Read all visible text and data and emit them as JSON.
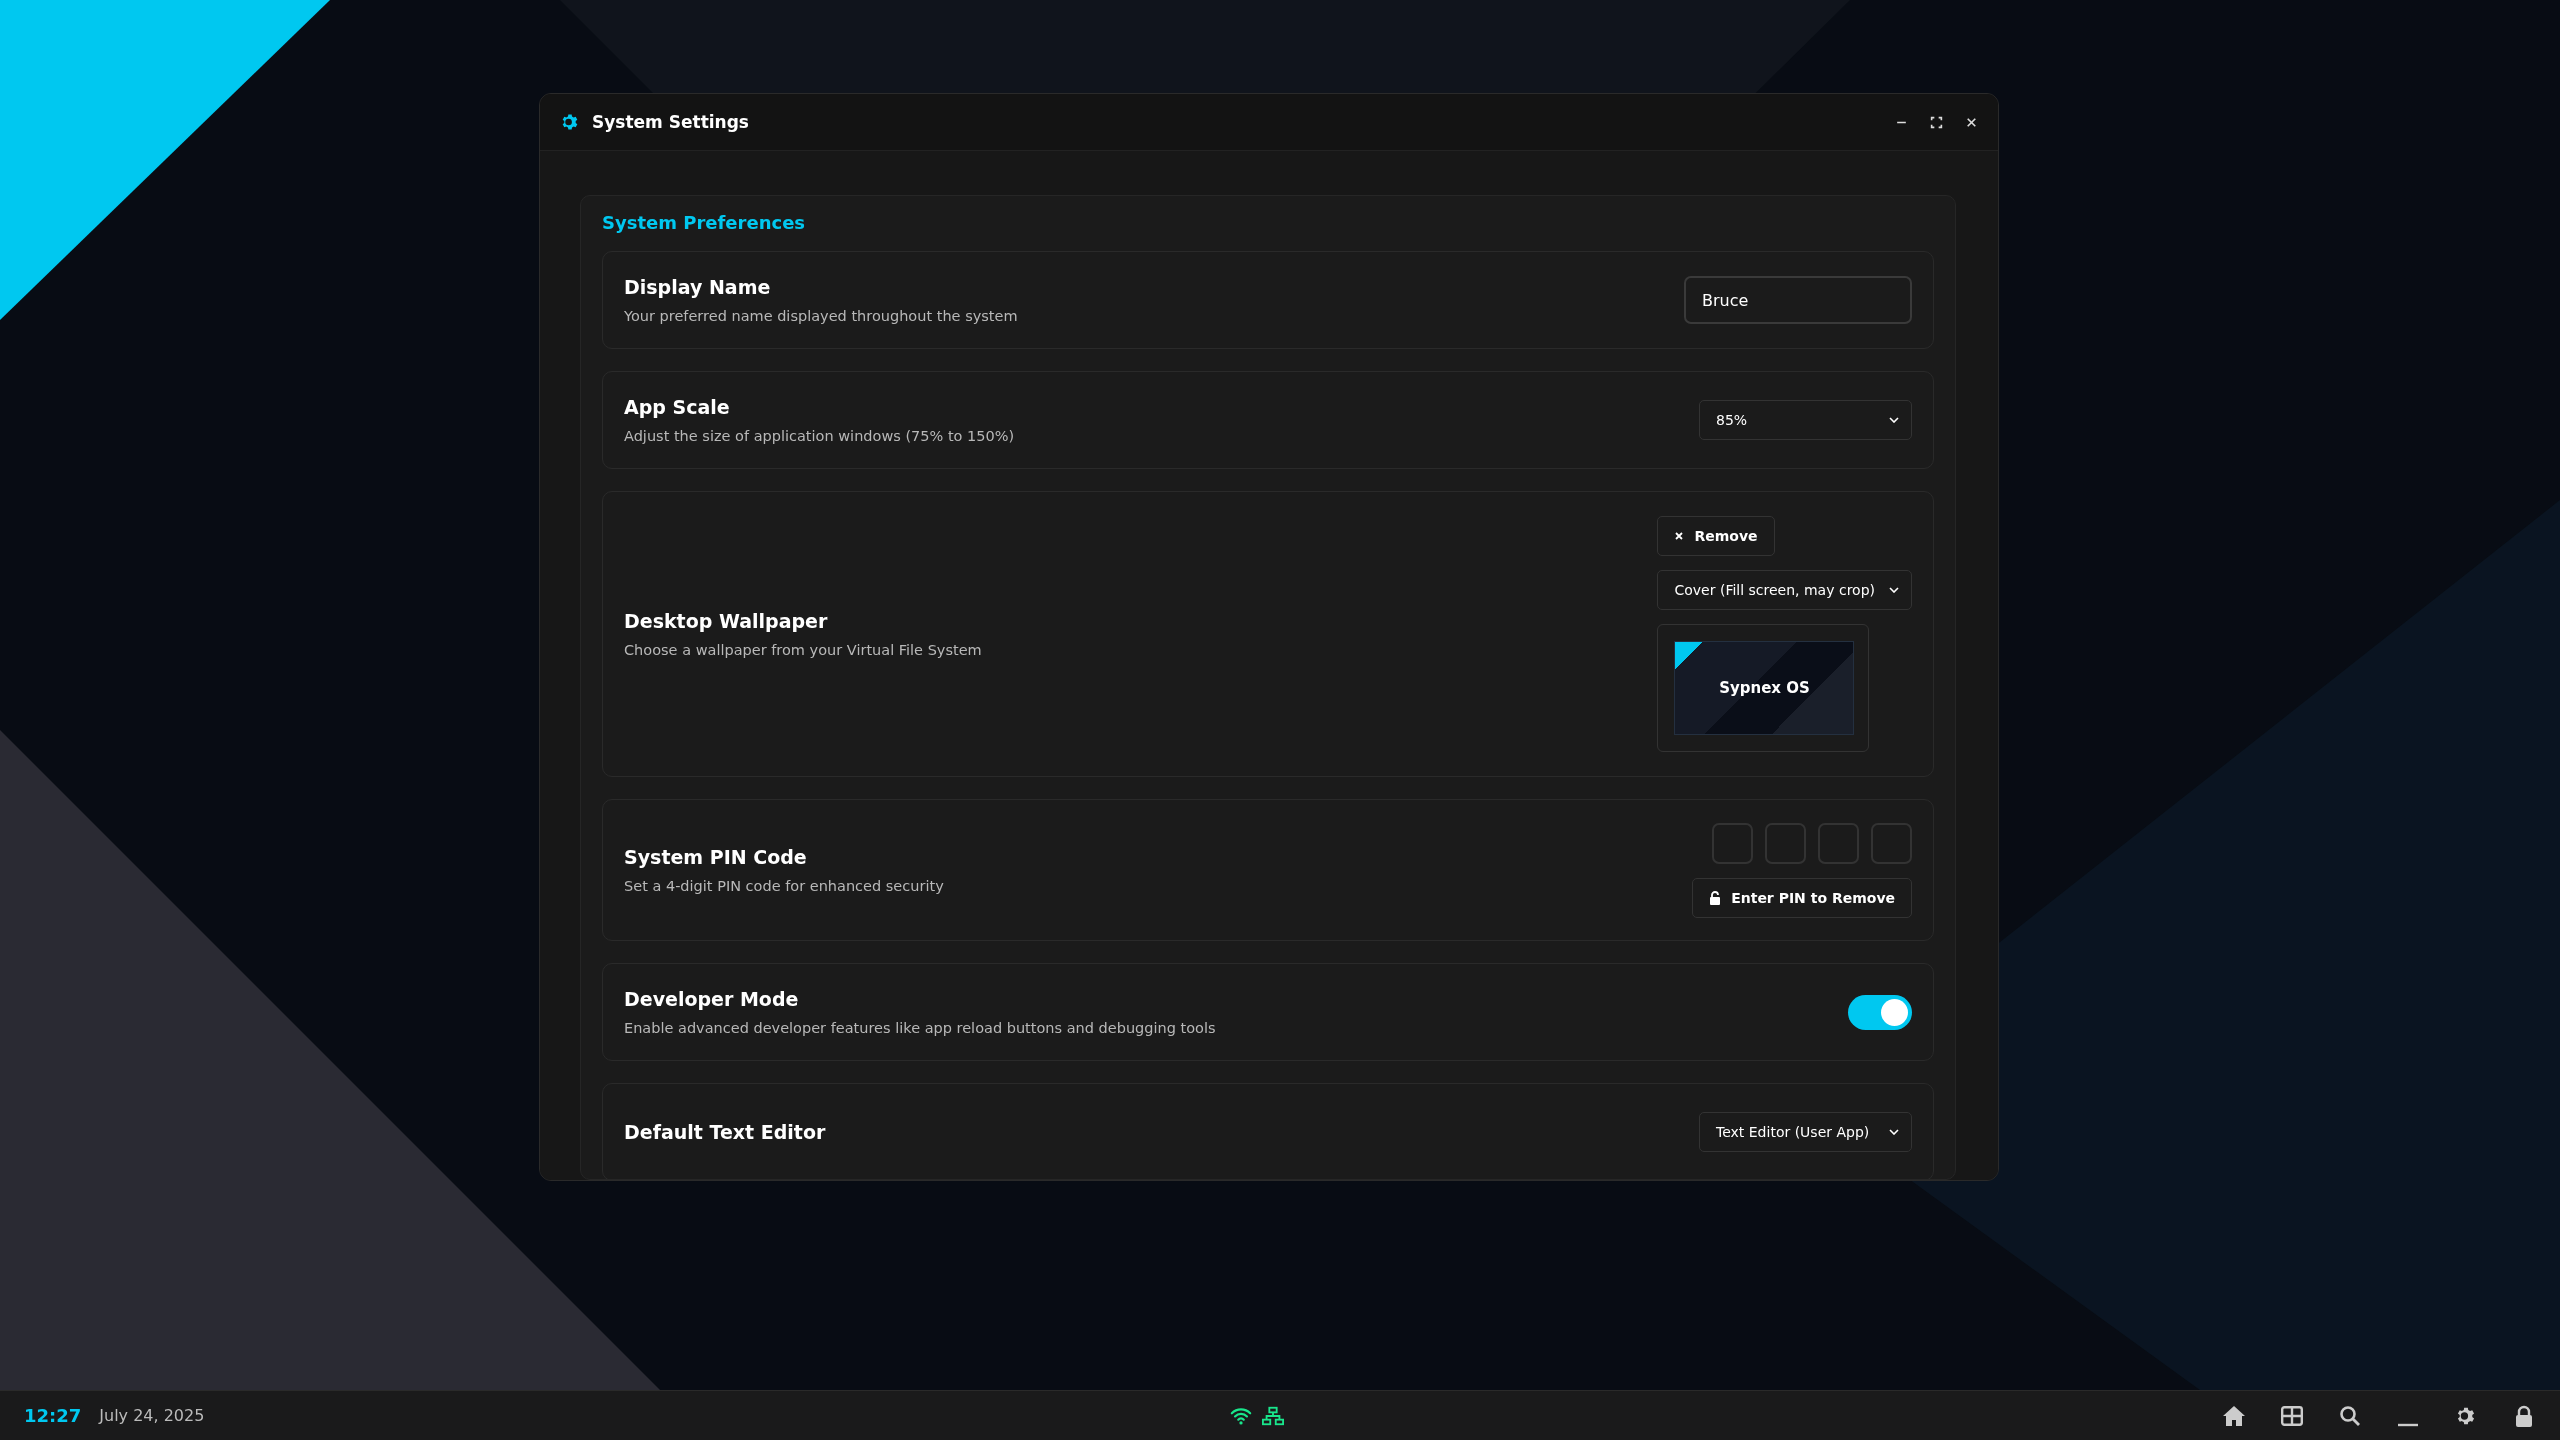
{
  "window": {
    "title": "System Settings"
  },
  "section": {
    "title": "System Preferences"
  },
  "settings": [
    {
      "kind": "input",
      "title": "Display Name",
      "description": "Your preferred name displayed throughout the system",
      "value": "Bruce"
    },
    {
      "kind": "select",
      "title": "App Scale",
      "description": "Adjust the size of application windows (75% to 150%)",
      "value": "85%"
    },
    {
      "kind": "wallpaper",
      "title": "Desktop Wallpaper",
      "description": "Choose a wallpaper from your Virtual File System",
      "remove_label": "Remove",
      "fit": "Cover (Fill screen, may crop)",
      "preview_label": "Sypnex OS"
    },
    {
      "kind": "pin",
      "title": "System PIN Code",
      "description": "Set a 4-digit PIN code for enhanced security",
      "button": "Enter PIN to Remove"
    },
    {
      "kind": "toggle",
      "title": "Developer Mode",
      "description": "Enable advanced developer features like app reload buttons and debugging tools",
      "on": true
    },
    {
      "kind": "select",
      "title": "Default Text Editor",
      "value": "Text Editor (User App)"
    }
  ],
  "taskbar": {
    "time": "12:27",
    "date": "July 24, 2025"
  }
}
